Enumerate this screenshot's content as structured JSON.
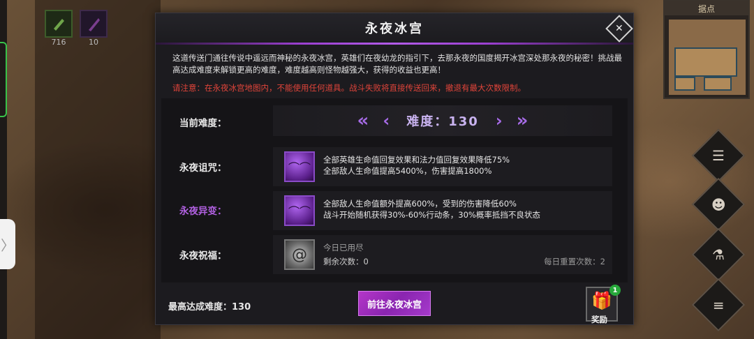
{
  "hud": {
    "slot1_count": "716",
    "slot2_count": "10",
    "minimap_title": "据点"
  },
  "dialog": {
    "title": "永夜冰宫",
    "close_icon": "close-icon",
    "intro": "这道传送门通往传说中遥远而神秘的永夜冰宫，英雄们在夜幼龙的指引下，去那永夜的国度揭开冰宫深处那永夜的秘密！挑战最高达成难度来解锁更高的难度，难度越高则怪物越强大，获得的收益也更高！",
    "warning": "请注意：在永夜冰宫地图内，不能使用任何道具。战斗失败将直接传送回来，撤退有最大次数限制。",
    "difficulty": {
      "label": "当前难度：",
      "value_text": "难度：130",
      "value": 130,
      "prev_fast": "«",
      "prev": "‹",
      "next": "›",
      "next_fast": "»"
    },
    "curse": {
      "label": "永夜诅咒：",
      "line1": "全部英雄生命值回复效果和法力值回复效果降低75%",
      "line2": "全部敌人生命值提高5400%，伤害提高1800%"
    },
    "mutation": {
      "label": "永夜异变：",
      "line1": "全部敌人生命值额外提高600%，受到的伤害降低60%",
      "line2": "战斗开始随机获得30%-60%行动条，30%概率抵挡不良状态"
    },
    "blessing": {
      "label": "永夜祝福：",
      "status": "今日已用尽",
      "remaining": "剩余次数：0",
      "reset": "每日重置次数：2"
    },
    "best_difficulty": "最高达成难度：130",
    "go_button": "前往永夜冰宫",
    "reward": {
      "label": "奖励",
      "badge": "1"
    }
  },
  "colors": {
    "accent_purple": "#9a3fd0",
    "warning_red": "#e0443a",
    "badge_green": "#27a83a"
  }
}
